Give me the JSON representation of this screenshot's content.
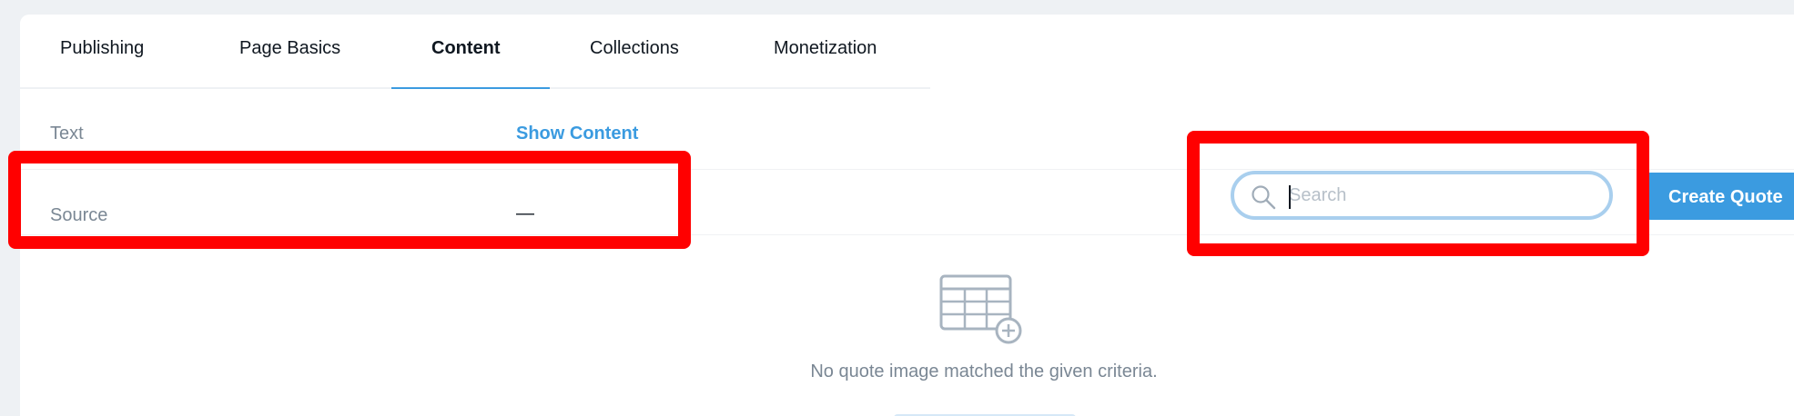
{
  "tabs": [
    {
      "label": "Publishing",
      "active": false
    },
    {
      "label": "Page Basics",
      "active": false
    },
    {
      "label": "Content",
      "active": true
    },
    {
      "label": "Collections",
      "active": false
    },
    {
      "label": "Monetization",
      "active": false
    }
  ],
  "fields": {
    "text": {
      "label": "Text",
      "action": "Show Content"
    },
    "source": {
      "label": "Source",
      "value": "—"
    }
  },
  "search": {
    "placeholder": "Search",
    "value": ""
  },
  "create_button": {
    "label": "Create Quote"
  },
  "empty_state": {
    "message": "No quote image matched the given criteria."
  },
  "colors": {
    "accent": "#3b9be0",
    "highlight": "#ff0000",
    "muted_text": "#7a8794",
    "background": "#eef1f4"
  },
  "icons": {
    "search": "search-icon",
    "empty": "table-add-icon"
  }
}
